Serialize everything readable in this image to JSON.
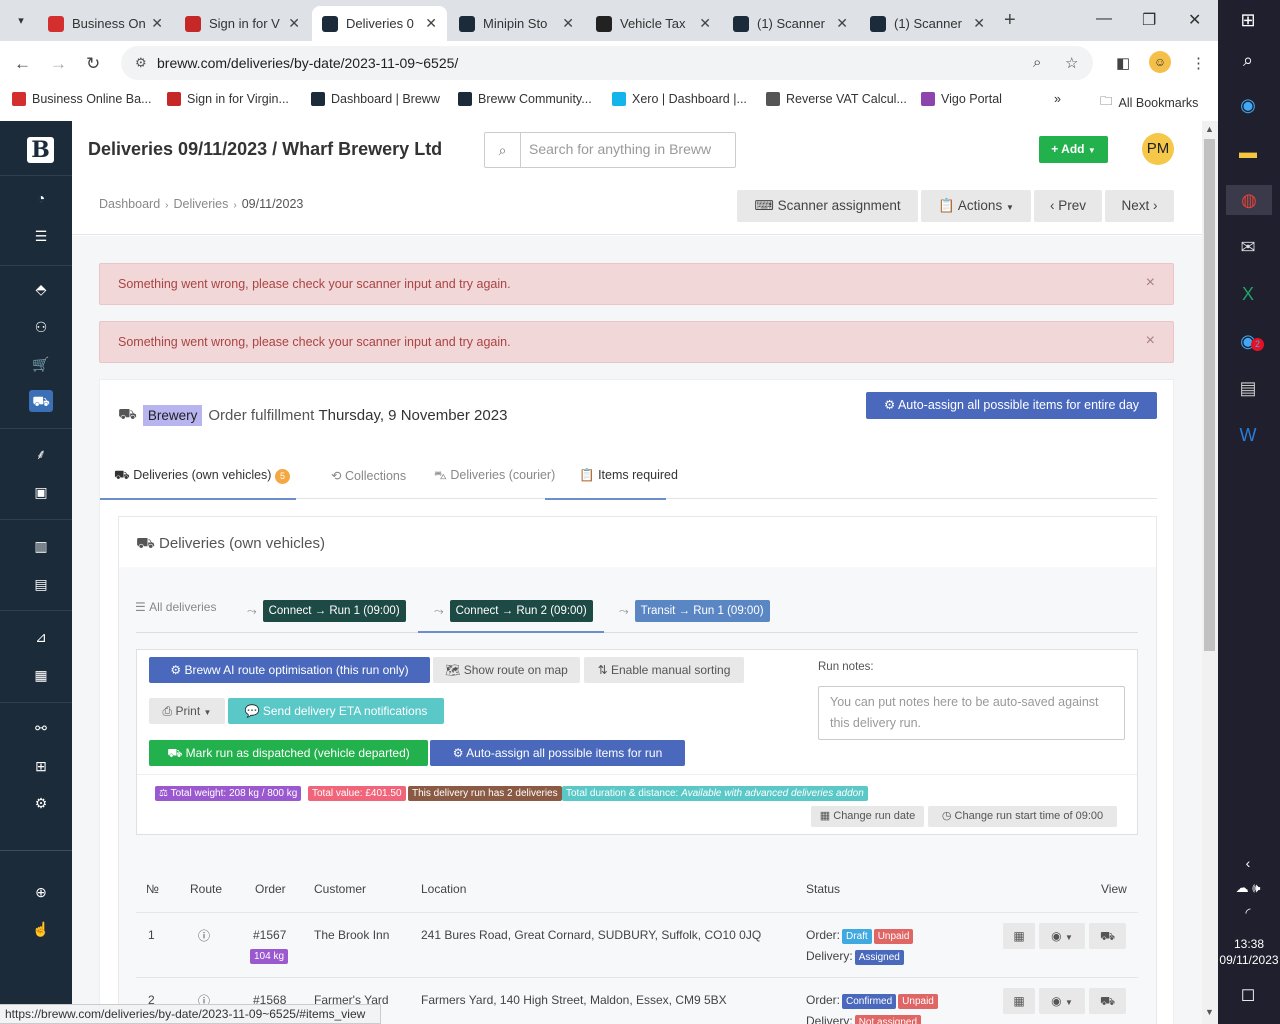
{
  "browser": {
    "tabs": [
      {
        "title": "Business On",
        "favicon_color": "#d32f2f"
      },
      {
        "title": "Sign in for V",
        "favicon_color": "#c62828"
      },
      {
        "title": "Deliveries 0",
        "favicon_color": "#1c2b3a"
      },
      {
        "title": "Minipin Sto",
        "favicon_color": "#1c2b3a"
      },
      {
        "title": "Vehicle Tax",
        "favicon_color": "#222222"
      },
      {
        "title": "(1) Scanner",
        "favicon_color": "#1c2b3a"
      },
      {
        "title": "(1) Scanner",
        "favicon_color": "#1c2b3a"
      }
    ],
    "url": "breww.com/deliveries/by-date/2023-11-09~6525/",
    "bookmarks": [
      {
        "label": "Business Online Ba...",
        "color": "#d32f2f"
      },
      {
        "label": "Sign in for Virgin...",
        "color": "#c62828"
      },
      {
        "label": "Dashboard | Breww",
        "color": "#1c2b3a"
      },
      {
        "label": "Breww Community...",
        "color": "#1c2b3a"
      },
      {
        "label": "Xero | Dashboard |...",
        "color": "#13b5ea"
      },
      {
        "label": "Reverse VAT Calcul...",
        "color": "#555555"
      },
      {
        "label": "Vigo Portal",
        "color": "#8e44ad"
      }
    ],
    "all_bookmarks": "All Bookmarks",
    "status_url": "https://breww.com/deliveries/by-date/2023-11-09~6525/#items_view"
  },
  "taskbar": {
    "time": "13:38",
    "date": "09/11/2023",
    "badge": "2"
  },
  "app": {
    "logo": "B",
    "page_title": "Deliveries 09/11/2023 / Wharf Brewery Ltd",
    "search_placeholder": "Search for anything in Breww",
    "add_label": "+ Add",
    "user_initials": "PM",
    "breadcrumb": [
      "Dashboard",
      "Deliveries",
      "09/11/2023"
    ],
    "toolbar": {
      "scanner": "Scanner assignment",
      "actions": "Actions",
      "prev": "Prev",
      "next": "Next"
    },
    "alerts": [
      "Something went wrong, please check your scanner input and try again.",
      "Something went wrong, please check your scanner input and try again."
    ],
    "fulfilment": {
      "badge": "Brewery",
      "label": "Order fulfillment",
      "date": "Thursday, 9 November 2023",
      "auto_day": "Auto-assign all possible items for entire day"
    },
    "main_tabs": [
      {
        "label": "Deliveries (own vehicles)",
        "count": "5"
      },
      {
        "label": "Collections"
      },
      {
        "label": "Deliveries (courier)"
      },
      {
        "label": "Items required"
      }
    ],
    "section_title": "Deliveries (own vehicles)",
    "run_tabs": {
      "all": "All deliveries",
      "runs": [
        {
          "label": "Connect → Run 1 (09:00)",
          "color": "#1e4a45"
        },
        {
          "label": "Connect → Run 2 (09:00)",
          "color": "#1e4a45"
        },
        {
          "label": "Transit → Run 1 (09:00)",
          "color": "#5b86c4"
        }
      ]
    },
    "run": {
      "ai_route": "Breww AI route optimisation (this run only)",
      "show_map": "Show route on map",
      "manual_sort": "Enable manual sorting",
      "print": "Print",
      "send_eta": "Send delivery ETA notifications",
      "dispatch": "Mark run as dispatched (vehicle departed)",
      "auto_run": "Auto-assign all possible items for run",
      "notes_label": "Run notes:",
      "notes_placeholder": "You can put notes here to be auto-saved against this delivery run.",
      "stats": {
        "weight": "Total weight: 208 kg / 800 kg",
        "value": "Total value: £401.50",
        "count": "This delivery run has 2 deliveries",
        "duration_label": "Total duration & distance:",
        "duration_note": "Available with advanced deliveries addon"
      },
      "change_date": "Change run date",
      "change_time": "Change run start time of 09:00"
    },
    "table": {
      "headers": [
        "№",
        "Route",
        "Order",
        "Customer",
        "Location",
        "Status",
        "View"
      ],
      "rows": [
        {
          "num": "1",
          "order": "#1567",
          "weight": "104 kg",
          "customer": "The Brook Inn",
          "location": "241 Bures Road, Great Cornard, SUDBURY, Suffolk, CO10 0JQ",
          "order_label": "Order:",
          "order_status": [
            {
              "text": "Draft",
              "color": "#3fa9e0"
            },
            {
              "text": "Unpaid",
              "color": "#e06565"
            }
          ],
          "delivery_label": "Delivery:",
          "delivery_status": {
            "text": "Assigned",
            "color": "#4a69bd"
          }
        },
        {
          "num": "2",
          "order": "#1568",
          "weight": "",
          "customer": "Farmer's Yard",
          "location": "Farmers Yard, 140 High Street, Maldon, Essex, CM9 5BX",
          "order_label": "Order:",
          "order_status": [
            {
              "text": "Confirmed",
              "color": "#4a69bd"
            },
            {
              "text": "Unpaid",
              "color": "#e06565"
            }
          ],
          "delivery_label": "Delivery:",
          "delivery_status": {
            "text": "Not assigned",
            "color": "#e06565"
          }
        }
      ]
    }
  }
}
